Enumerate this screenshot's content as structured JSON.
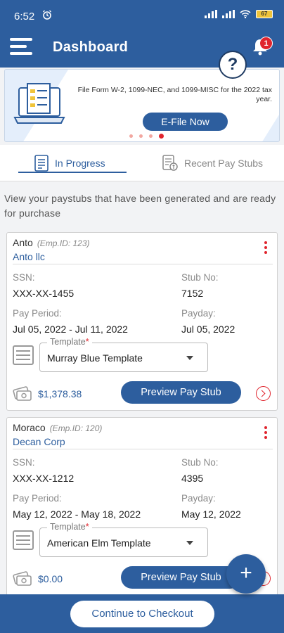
{
  "status": {
    "time": "6:52",
    "battery": "67"
  },
  "appbar": {
    "title": "Dashboard",
    "notification_count": "1",
    "help": "?"
  },
  "banner": {
    "text": "File Form W-2, 1099-NEC, and 1099-MISC for the 2022 tax year.",
    "button": "E-File Now",
    "slides": 4,
    "active_slide": 4
  },
  "tabs": [
    {
      "label": "In Progress",
      "active": true
    },
    {
      "label": "Recent Pay Stubs",
      "active": false
    }
  ],
  "intro": "View your paystubs that have been generated and are ready for purchase",
  "labels": {
    "ssn": "SSN:",
    "stub_no": "Stub No:",
    "pay_period": "Pay Period:",
    "payday": "Payday:",
    "template": "Template",
    "required": "*",
    "preview": "Preview Pay Stub"
  },
  "stubs": [
    {
      "name": "Anto",
      "emp_id": "(Emp.ID: 123)",
      "company": "Anto llc",
      "ssn": "XXX-XX-1455",
      "stub_no": "7152",
      "pay_period": "Jul 05, 2022 - Jul 11, 2022",
      "payday": "Jul 05, 2022",
      "template": "Murray Blue Template",
      "amount": "$1,378.38"
    },
    {
      "name": "Moraco",
      "emp_id": "(Emp.ID: 120)",
      "company": "Decan Corp",
      "ssn": "XXX-XX-1212",
      "stub_no": "4395",
      "pay_period": "May 12, 2022 - May 18, 2022",
      "payday": "May 12, 2022",
      "template": "American Elm Template",
      "amount": "$0.00"
    }
  ],
  "fab": "+",
  "checkout": "Continue to Checkout",
  "colors": {
    "primary": "#2d5e9e",
    "accent": "#e0242d",
    "background": "#f2f3f5"
  }
}
